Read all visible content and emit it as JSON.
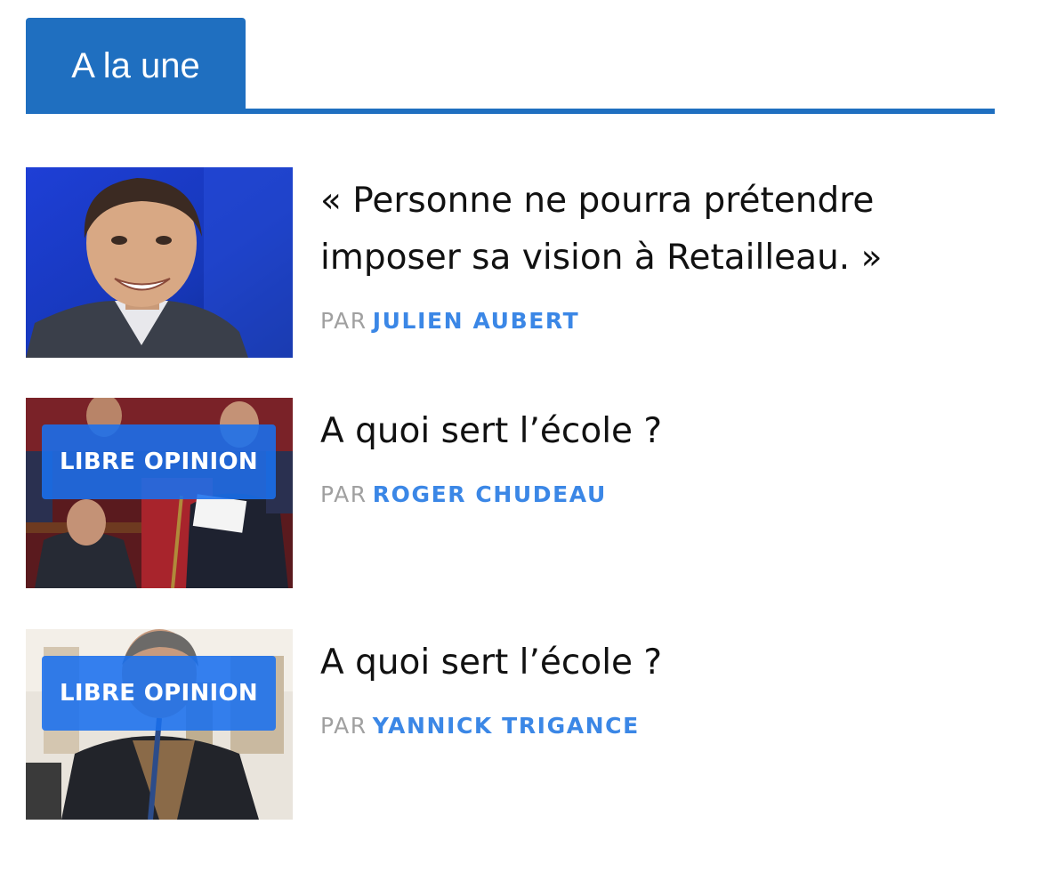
{
  "section": {
    "tab_label": "A la une",
    "accent_color": "#1f6fc0"
  },
  "articles": [
    {
      "headline": "« Personne ne pourra prétendre imposer sa vision à Retailleau. »",
      "byline_prefix": "PAR",
      "author": "JULIEN AUBERT",
      "badge": ""
    },
    {
      "headline": "A quoi sert l’école ?",
      "byline_prefix": "PAR",
      "author": "ROGER CHUDEAU",
      "badge": "LIBRE OPINION"
    },
    {
      "headline": "A quoi sert l’école ?",
      "byline_prefix": "PAR",
      "author": "YANNICK TRIGANCE",
      "badge": "LIBRE OPINION"
    }
  ],
  "colors": {
    "author": "#3b87e6",
    "byline_prefix": "#a0a0a0",
    "badge": "#1970ee",
    "headline": "#111111"
  }
}
